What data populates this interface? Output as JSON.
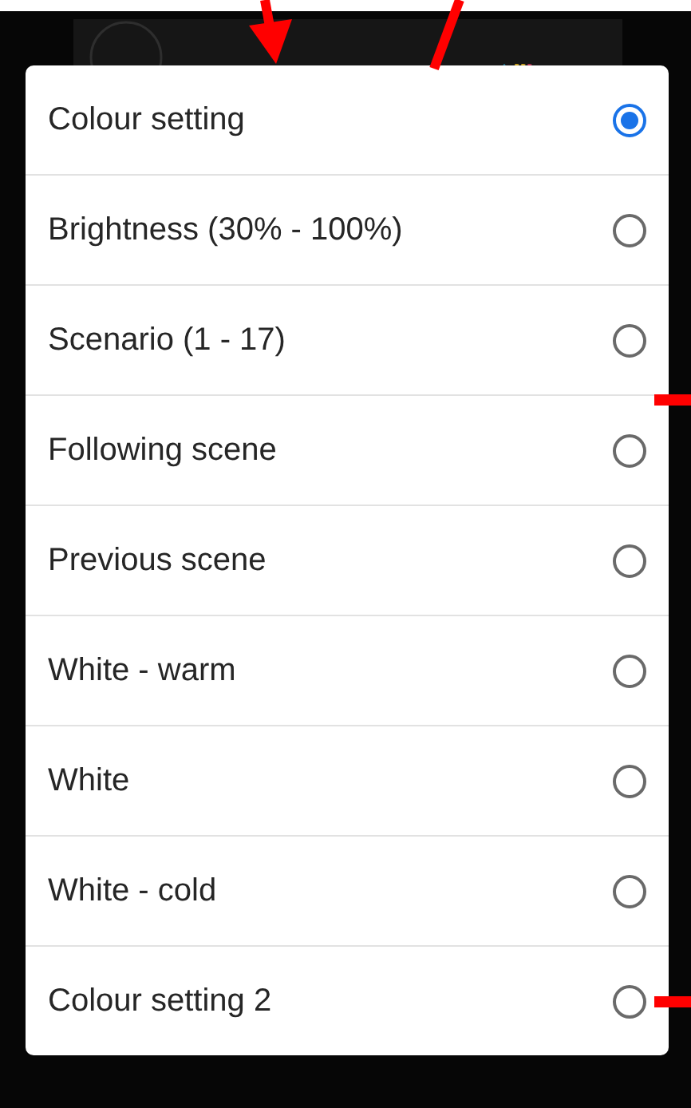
{
  "options": [
    {
      "label": "Colour setting",
      "selected": true
    },
    {
      "label": "Brightness (30% - 100%)",
      "selected": false
    },
    {
      "label": "Scenario (1 - 17)",
      "selected": false
    },
    {
      "label": "Following scene",
      "selected": false
    },
    {
      "label": "Previous scene",
      "selected": false
    },
    {
      "label": "White - warm",
      "selected": false
    },
    {
      "label": "White",
      "selected": false
    },
    {
      "label": "White - cold",
      "selected": false
    },
    {
      "label": "Colour setting 2",
      "selected": false
    }
  ]
}
